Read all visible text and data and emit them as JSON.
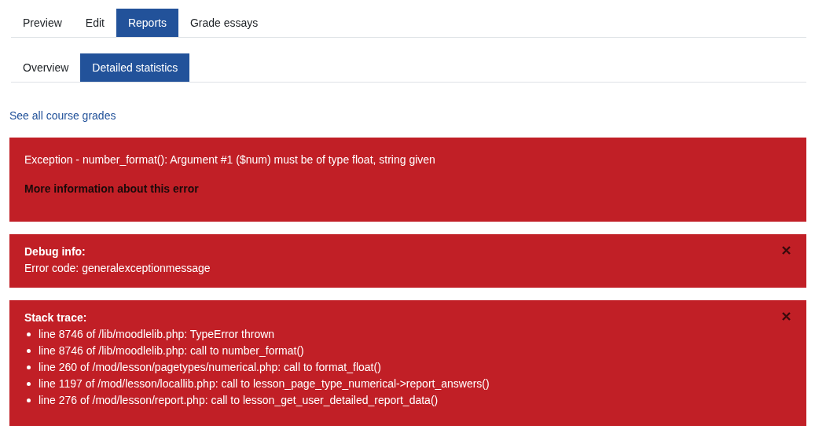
{
  "tabs": [
    {
      "label": "Preview",
      "selected": false
    },
    {
      "label": "Edit",
      "selected": false
    },
    {
      "label": "Reports",
      "selected": true
    },
    {
      "label": "Grade essays",
      "selected": false
    }
  ],
  "subtabs": [
    {
      "label": "Overview",
      "selected": false
    },
    {
      "label": "Detailed statistics",
      "selected": true
    }
  ],
  "link": "See all course grades",
  "exception": {
    "message": "Exception - number_format(): Argument #1 ($num) must be of type float, string given",
    "more_info": "More information about this error"
  },
  "debug": {
    "title": "Debug info:",
    "text": "Error code: generalexceptionmessage"
  },
  "stack": {
    "title": "Stack trace:",
    "lines": [
      "line 8746 of /lib/moodlelib.php: TypeError thrown",
      "line 8746 of /lib/moodlelib.php: call to number_format()",
      "line 260 of /mod/lesson/pagetypes/numerical.php: call to format_float()",
      "line 1197 of /mod/lesson/locallib.php: call to lesson_page_type_numerical->report_answers()",
      "line 276 of /mod/lesson/report.php: call to lesson_get_user_detailed_report_data()"
    ]
  }
}
